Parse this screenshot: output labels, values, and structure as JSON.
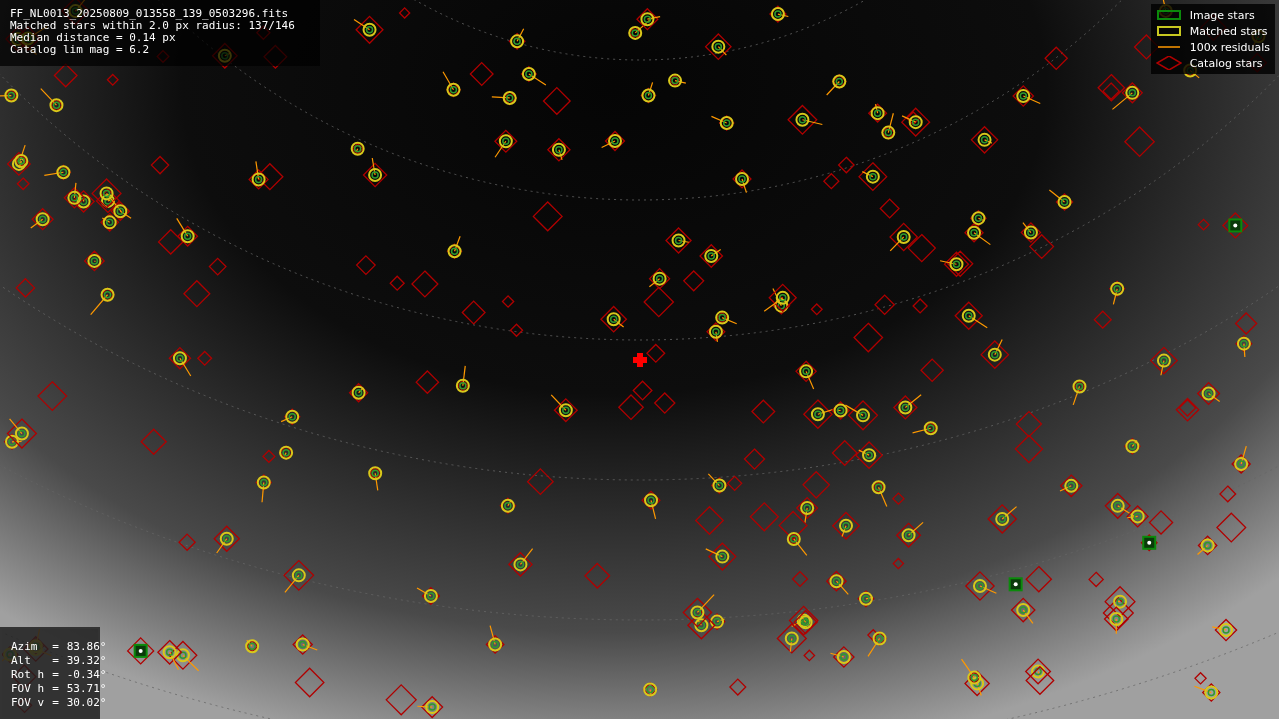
{
  "info_panel": {
    "lines": [
      "FF_NL0013_20250809_013558_139_0503296.fits",
      "Matched stars within 2.0 px radius: 137/146",
      "Median distance = 0.14 px",
      "Catalog lim mag = 6.2"
    ]
  },
  "legend": {
    "items": [
      {
        "label": "Image stars",
        "kind": "image"
      },
      {
        "label": "Matched stars",
        "kind": "matched"
      },
      {
        "label": "100x residuals",
        "kind": "residual"
      },
      {
        "label": "Catalog stars",
        "kind": "catalog"
      }
    ]
  },
  "pointing_panel": {
    "rows": [
      {
        "label": "Azim",
        "sep": "=",
        "value": "83.86°"
      },
      {
        "label": "Alt",
        "sep": "=",
        "value": "39.32°"
      },
      {
        "label": "Rot h",
        "sep": "=",
        "value": "-0.34°"
      },
      {
        "label": "FOV h",
        "sep": "=",
        "value": "53.71°"
      },
      {
        "label": "FOV v",
        "sep": "=",
        "value": "30.02°"
      }
    ]
  }
}
